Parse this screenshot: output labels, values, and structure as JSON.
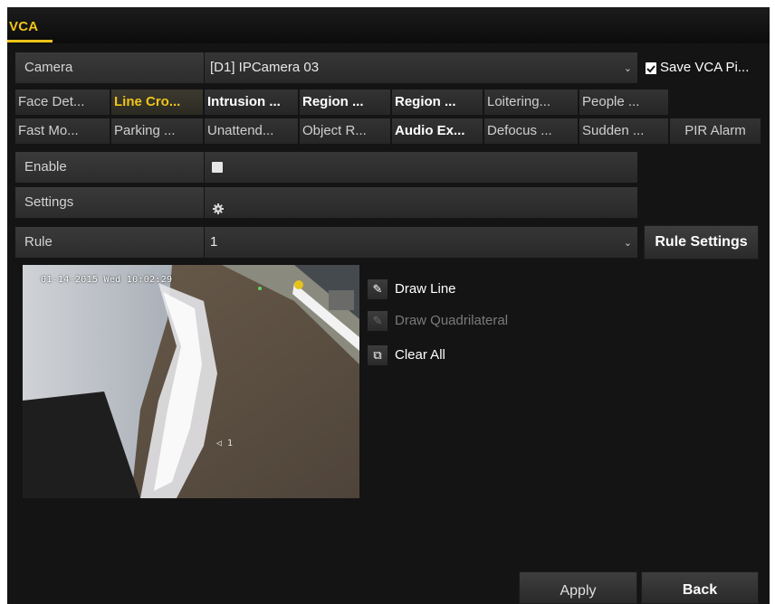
{
  "window": {
    "title": "VCA"
  },
  "camera": {
    "label": "Camera",
    "value": "[D1] IPCamera 03",
    "save_pic_label": "Save VCA Pi...",
    "save_pic_checked": true
  },
  "tabs_row1": [
    {
      "label": "Face Det...",
      "active": false
    },
    {
      "label": "Line Cro...",
      "active": true
    },
    {
      "label": "Intrusion ...",
      "active": false
    },
    {
      "label": "Region ...",
      "active": false
    },
    {
      "label": "Region ...",
      "active": false
    },
    {
      "label": "Loitering...",
      "active": false
    },
    {
      "label": "People ...",
      "active": false
    }
  ],
  "tabs_row2": [
    {
      "label": "Fast Mo...",
      "active": false
    },
    {
      "label": "Parking ...",
      "active": false
    },
    {
      "label": "Unattend...",
      "active": false
    },
    {
      "label": "Object R...",
      "active": false
    },
    {
      "label": "Audio Ex...",
      "active": false
    },
    {
      "label": "Defocus ...",
      "active": false
    },
    {
      "label": "Sudden ...",
      "active": false
    },
    {
      "label": "PIR Alarm",
      "active": false
    }
  ],
  "enable": {
    "label": "Enable",
    "checked": false
  },
  "settings": {
    "label": "Settings",
    "icon": "gear-icon"
  },
  "rule": {
    "label": "Rule",
    "value": "1",
    "button": "Rule Settings"
  },
  "preview": {
    "timestamp": "01-14-2015 Wed 10:02:29",
    "line_marker": "1"
  },
  "tools": {
    "draw_line": "Draw Line",
    "draw_quadrilateral": "Draw Quadrilateral",
    "clear_all": "Clear All"
  },
  "footer": {
    "apply": "Apply",
    "back": "Back"
  },
  "colors": {
    "accent": "#f0c419",
    "background": "#141414",
    "panel": "#2f2f2f"
  }
}
